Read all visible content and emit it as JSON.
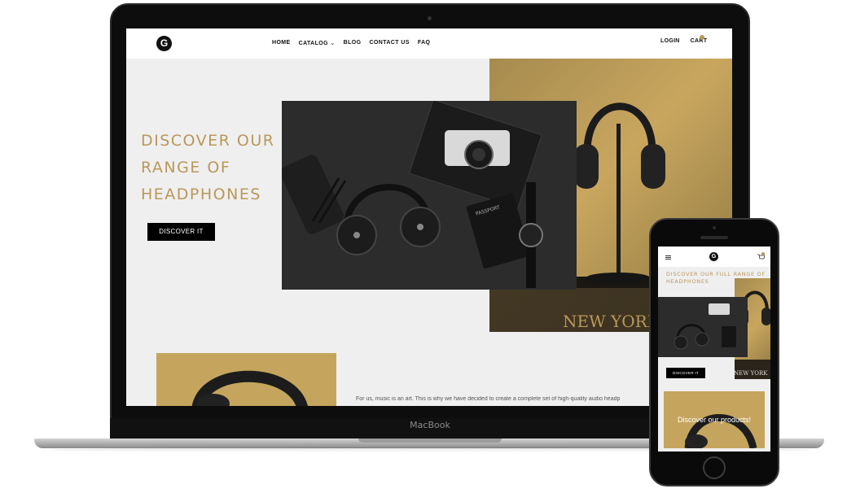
{
  "laptop": {
    "brand_label": "MacBook"
  },
  "site": {
    "logo_letter": "G",
    "nav": {
      "menu": [
        {
          "label": "HOME"
        },
        {
          "label": "CATALOG"
        },
        {
          "label": "BLOG"
        },
        {
          "label": "CONTACT US"
        },
        {
          "label": "FAQ"
        }
      ],
      "catalog_chevron": "⌄",
      "login_label": "LOGIN",
      "cart_label": "CART"
    },
    "hero": {
      "title": "DISCOVER OUR FULL RANGE OF HEADPHONES",
      "button_label": "DISCOVER IT",
      "photo_caption_passport": "PASSPORT",
      "banner_text": "NEW YORK"
    },
    "intro_text": "For us, music is an art. This is why we have decided to create a complete set of high-quality audio headp"
  },
  "phone": {
    "logo_letter": "G",
    "hero_title": "DISCOVER OUR FULL RANGE OF HEADPHONES",
    "button_label": "DISCOVER IT",
    "banner_text": "NEW YORK",
    "products_label": "Discover our products!"
  },
  "colors": {
    "accent_gold": "#b9985a",
    "button_black": "#000000"
  }
}
